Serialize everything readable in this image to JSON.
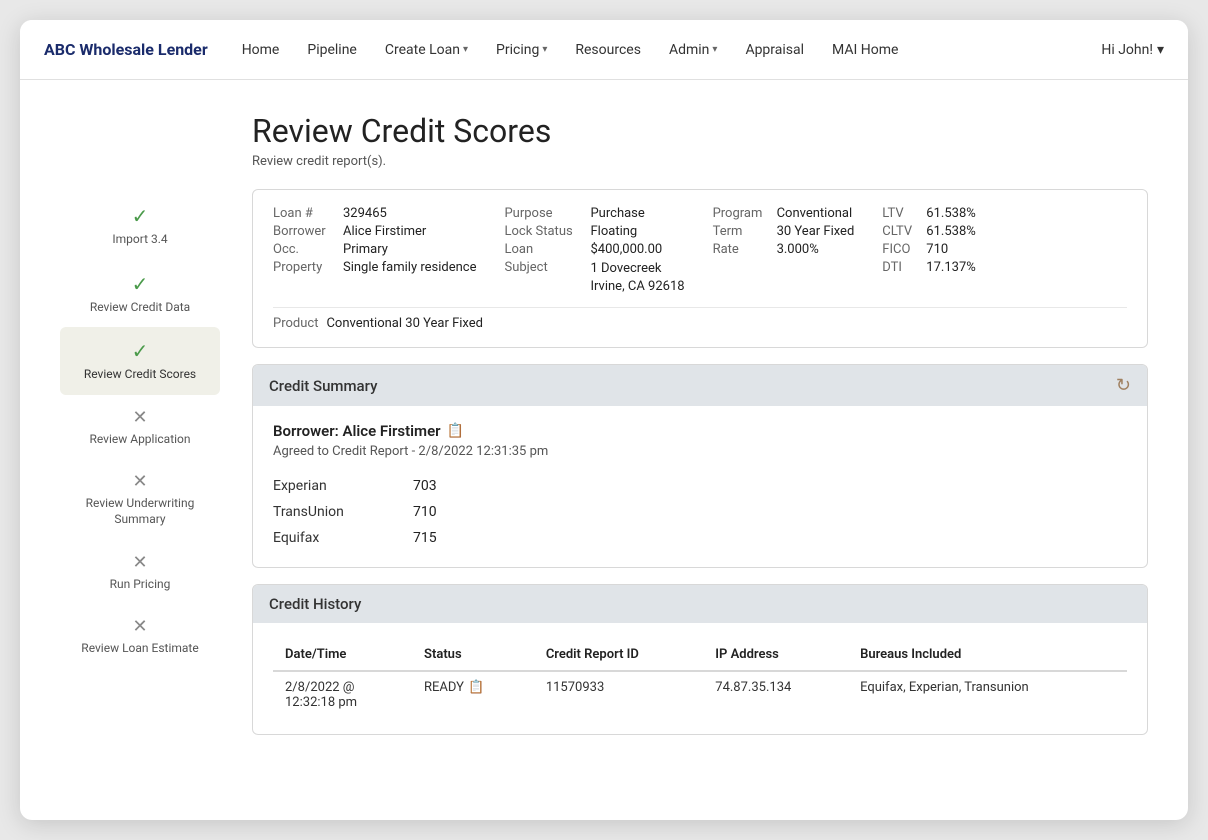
{
  "app": {
    "brand": "ABC Wholesale Lender",
    "nav_items": [
      {
        "label": "Home",
        "has_caret": false
      },
      {
        "label": "Pipeline",
        "has_caret": false
      },
      {
        "label": "Create Loan",
        "has_caret": true
      },
      {
        "label": "Pricing",
        "has_caret": true
      },
      {
        "label": "Resources",
        "has_caret": false
      },
      {
        "label": "Admin",
        "has_caret": true
      },
      {
        "label": "Appraisal",
        "has_caret": false
      },
      {
        "label": "MAI Home",
        "has_caret": false
      }
    ],
    "user": "Hi John!"
  },
  "page": {
    "title": "Review Credit Scores",
    "subtitle": "Review credit report(s)."
  },
  "sidebar": {
    "items": [
      {
        "label": "Import 3.4",
        "icon": "check",
        "active": false
      },
      {
        "label": "Review Credit Data",
        "icon": "check",
        "active": false
      },
      {
        "label": "Review Credit Scores",
        "icon": "check",
        "active": true
      },
      {
        "label": "Review Application",
        "icon": "cross",
        "active": false
      },
      {
        "label": "Review Underwriting Summary",
        "icon": "cross",
        "active": false
      },
      {
        "label": "Run Pricing",
        "icon": "cross",
        "active": false
      },
      {
        "label": "Review Loan Estimate",
        "icon": "cross",
        "active": false
      }
    ]
  },
  "loan": {
    "fields_col1": [
      {
        "label": "Loan #",
        "value": "329465"
      },
      {
        "label": "Borrower",
        "value": "Alice Firstimer"
      },
      {
        "label": "Occ.",
        "value": "Primary"
      },
      {
        "label": "Property",
        "value": "Single family residence"
      }
    ],
    "fields_col2": [
      {
        "label": "Purpose",
        "value": "Purchase"
      },
      {
        "label": "Lock Status",
        "value": "Floating"
      },
      {
        "label": "Loan",
        "value": "$400,000.00"
      },
      {
        "label": "Subject",
        "value": "1 Dovecreek\nIrvine, CA 92618"
      }
    ],
    "fields_col3": [
      {
        "label": "Program",
        "value": "Conventional"
      },
      {
        "label": "Term",
        "value": "30 Year Fixed"
      },
      {
        "label": "Rate",
        "value": "3.000%"
      }
    ],
    "fields_col4": [
      {
        "label": "LTV",
        "value": "61.538%"
      },
      {
        "label": "CLTV",
        "value": "61.538%"
      },
      {
        "label": "FICO",
        "value": "710"
      },
      {
        "label": "DTI",
        "value": "17.137%"
      }
    ],
    "product_label": "Product",
    "product_value": "Conventional 30 Year Fixed"
  },
  "credit_summary": {
    "section_title": "Credit Summary",
    "borrower_name": "Borrower: Alice Firstimer",
    "agreed_text": "Agreed to Credit Report - 2/8/2022 12:31:35 pm",
    "scores": [
      {
        "bureau": "Experian",
        "score": "703"
      },
      {
        "bureau": "TransUnion",
        "score": "710"
      },
      {
        "bureau": "Equifax",
        "score": "715"
      }
    ]
  },
  "credit_history": {
    "section_title": "Credit History",
    "columns": [
      "Date/Time",
      "Status",
      "Credit Report ID",
      "IP Address",
      "Bureaus Included"
    ],
    "rows": [
      {
        "date_time": "2/8/2022 @\n12:32:18 pm",
        "status": "READY",
        "credit_report_id": "11570933",
        "ip_address": "74.87.35.134",
        "bureaus": "Equifax, Experian, Transunion"
      }
    ]
  }
}
